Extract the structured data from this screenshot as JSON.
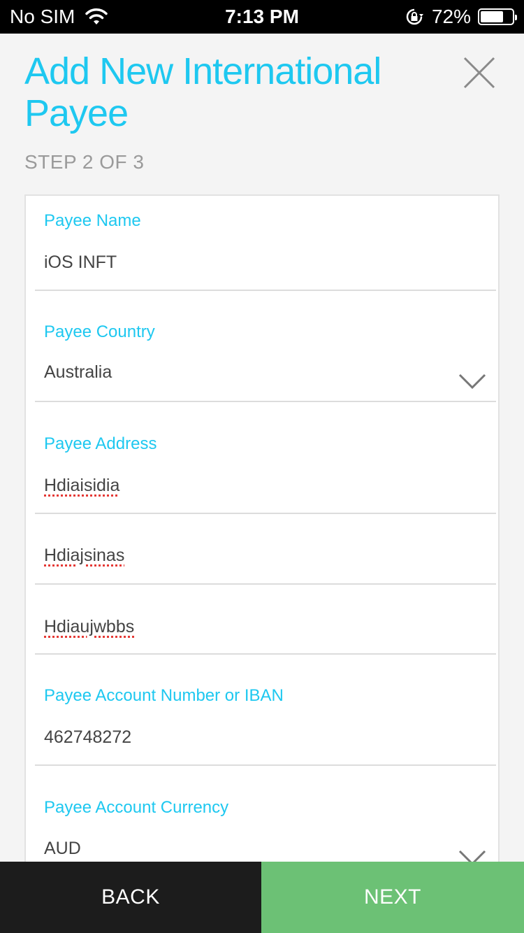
{
  "status_bar": {
    "carrier": "No SIM",
    "time": "7:13 PM",
    "battery_text": "72%",
    "battery_level": 0.72,
    "icons": [
      "wifi-icon",
      "rotation-lock-icon",
      "battery-icon"
    ]
  },
  "header": {
    "title": "Add New International Payee",
    "step": "STEP 2 OF 3",
    "close_icon": "close-icon"
  },
  "form": {
    "payee_name": {
      "label": "Payee Name",
      "value": "iOS INFT"
    },
    "payee_country": {
      "label": "Payee Country",
      "value": "Australia",
      "icon": "chevron-down-icon"
    },
    "payee_address": {
      "label": "Payee Address",
      "line1": "Hdiaisidia",
      "line2": "Hdiajsinas",
      "line3": "Hdiaujwbbs"
    },
    "payee_account_number": {
      "label": "Payee Account Number or IBAN",
      "value": "462748272"
    },
    "payee_account_currency": {
      "label": "Payee Account Currency",
      "value": "AUD",
      "icon": "chevron-down-icon"
    }
  },
  "buttons": {
    "back": "BACK",
    "next": "NEXT"
  },
  "colors": {
    "accent": "#1ec8f0",
    "next_button": "#6cc175",
    "back_button": "#1c1c1c",
    "background": "#f4f4f4"
  }
}
